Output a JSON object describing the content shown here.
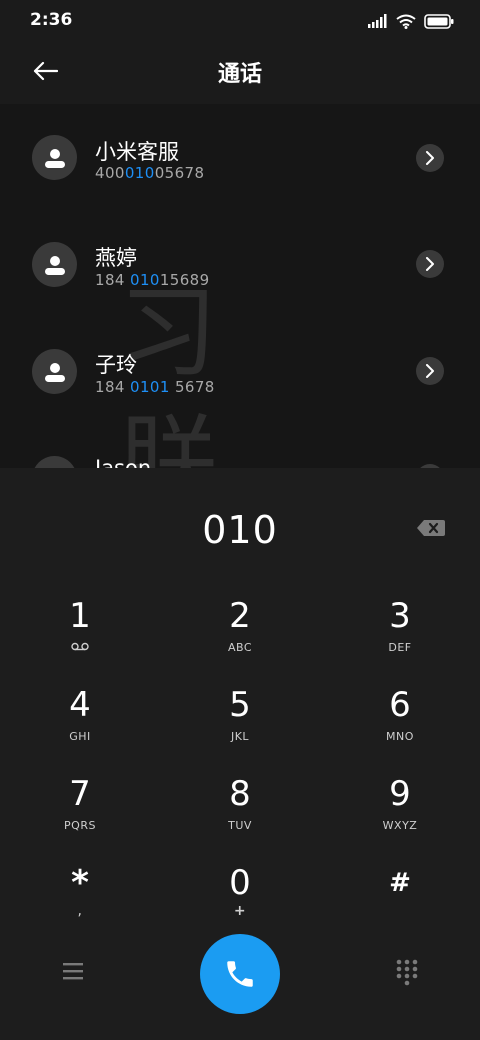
{
  "status_bar": {
    "time": "2:36"
  },
  "header": {
    "title": "通话"
  },
  "contacts": [
    {
      "name": "小米客服",
      "number_pre": "400",
      "number_match": "010",
      "number_post": "05678"
    },
    {
      "name": "燕婷",
      "number_pre": "184 ",
      "number_match": "010",
      "number_post": "15689"
    },
    {
      "name": "子玲",
      "number_pre": "184 ",
      "number_match": "0101",
      "number_post": " 5678"
    },
    {
      "name": "Jason",
      "number_pre": "",
      "number_match": "",
      "number_post": ""
    }
  ],
  "dialer": {
    "input": "010",
    "keys": [
      {
        "digit": "1",
        "letters": ""
      },
      {
        "digit": "2",
        "letters": "ABC"
      },
      {
        "digit": "3",
        "letters": "DEF"
      },
      {
        "digit": "4",
        "letters": "GHI"
      },
      {
        "digit": "5",
        "letters": "JKL"
      },
      {
        "digit": "6",
        "letters": "MNO"
      },
      {
        "digit": "7",
        "letters": "PQRS"
      },
      {
        "digit": "8",
        "letters": "TUV"
      },
      {
        "digit": "9",
        "letters": "WXYZ"
      },
      {
        "digit": "*",
        "letters": ","
      },
      {
        "digit": "0",
        "letters": "+"
      },
      {
        "digit": "#",
        "letters": ""
      }
    ]
  },
  "icons": {
    "back": "arrow-left-icon",
    "avatar": "person-icon",
    "chevron": "chevron-right-icon",
    "backspace": "backspace-icon",
    "voicemail": "voicemail-icon",
    "menu": "menu-icon",
    "call": "phone-icon",
    "keypad": "dialpad-icon"
  },
  "colors": {
    "accent": "#1b9cf2",
    "match_highlight": "#1e8ff5"
  }
}
